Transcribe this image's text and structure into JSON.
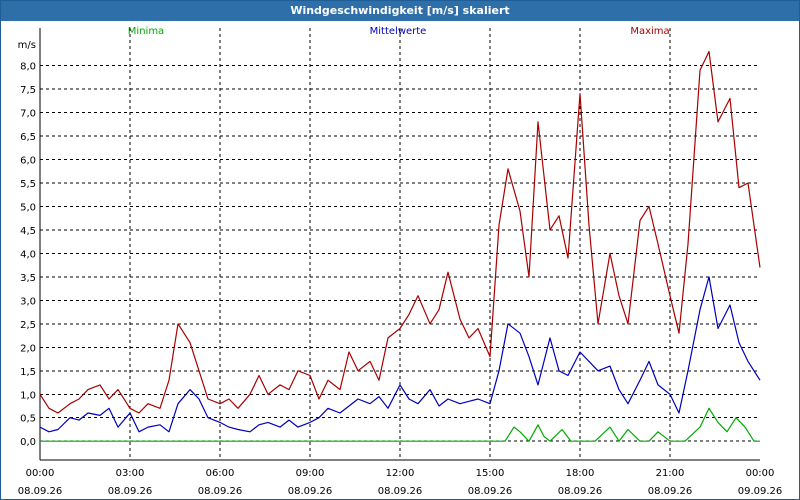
{
  "window": {
    "title": "Windgeschwindigkeit [m/s] skaliert"
  },
  "chart_data": {
    "type": "line",
    "ylabel": "m/s",
    "ylim": [
      -0.4,
      8.8
    ],
    "yticks": [
      "0,0",
      "0,5",
      "1,0",
      "1,5",
      "2,0",
      "2,5",
      "3,0",
      "3,5",
      "4,0",
      "4,5",
      "5,0",
      "5,5",
      "6,0",
      "6,5",
      "7,0",
      "7,5",
      "8,0"
    ],
    "x_time_labels": [
      "00:00",
      "03:00",
      "06:00",
      "09:00",
      "12:00",
      "15:00",
      "18:00",
      "21:00",
      "00:00"
    ],
    "x_date_labels": [
      "08.09.26",
      "08.09.26",
      "08.09.26",
      "08.09.26",
      "08.09.26",
      "08.09.26",
      "08.09.26",
      "08.09.26",
      "09.09.26"
    ],
    "x_hours": [
      0,
      24
    ],
    "grid": true,
    "legend": {
      "placement": "top"
    },
    "series": [
      {
        "name": "Minima",
        "color": "#00aa00",
        "x": [
          0,
          0.5,
          1,
          1.5,
          2,
          2.5,
          3,
          3.5,
          4,
          4.5,
          5,
          5.5,
          6,
          6.5,
          7,
          7.5,
          8,
          8.5,
          9,
          9.5,
          10,
          10.5,
          11,
          11.5,
          12,
          12.5,
          13,
          13.5,
          14,
          14.5,
          15,
          15.2,
          15.5,
          15.8,
          16.0,
          16.3,
          16.6,
          16.8,
          17.0,
          17.4,
          17.7,
          18.0,
          18.5,
          19,
          19.3,
          19.6,
          20,
          20.3,
          20.6,
          21,
          21.5,
          22,
          22.3,
          22.6,
          22.9,
          23.2,
          23.5,
          23.8,
          24
        ],
        "values": [
          0,
          0,
          0,
          0,
          0,
          0,
          0,
          0,
          0,
          0,
          0,
          0,
          0,
          0,
          0,
          0,
          0,
          0,
          0,
          0,
          0,
          0,
          0,
          0,
          0,
          0,
          0,
          0,
          0,
          0,
          0,
          0,
          0,
          0.3,
          0.2,
          0,
          0.35,
          0.1,
          0,
          0.25,
          0,
          0,
          0,
          0.3,
          0,
          0.25,
          0,
          0,
          0.2,
          0,
          0,
          0.3,
          0.7,
          0.4,
          0.2,
          0.5,
          0.3,
          0,
          0
        ]
      },
      {
        "name": "Mittelwerte",
        "color": "#0000bb",
        "x": [
          0,
          0.3,
          0.6,
          1,
          1.3,
          1.6,
          2,
          2.3,
          2.6,
          3,
          3.3,
          3.6,
          4,
          4.3,
          4.6,
          5,
          5.3,
          5.6,
          6,
          6.3,
          6.6,
          7,
          7.3,
          7.6,
          8,
          8.3,
          8.6,
          9,
          9.3,
          9.6,
          10,
          10.3,
          10.6,
          11,
          11.3,
          11.6,
          12,
          12.3,
          12.6,
          13,
          13.3,
          13.6,
          14,
          14.3,
          14.6,
          15,
          15.3,
          15.6,
          16,
          16.3,
          16.6,
          17,
          17.3,
          17.6,
          18,
          18.3,
          18.6,
          19,
          19.3,
          19.6,
          20,
          20.3,
          20.6,
          21,
          21.3,
          21.6,
          22,
          22.3,
          22.6,
          23,
          23.3,
          23.6,
          24
        ],
        "values": [
          0.3,
          0.2,
          0.25,
          0.5,
          0.45,
          0.6,
          0.55,
          0.7,
          0.3,
          0.6,
          0.2,
          0.3,
          0.35,
          0.2,
          0.8,
          1.1,
          0.9,
          0.5,
          0.4,
          0.3,
          0.25,
          0.2,
          0.35,
          0.4,
          0.3,
          0.45,
          0.3,
          0.4,
          0.5,
          0.7,
          0.6,
          0.75,
          0.9,
          0.8,
          0.95,
          0.7,
          1.2,
          0.9,
          0.8,
          1.1,
          0.75,
          0.9,
          0.8,
          0.85,
          0.9,
          0.8,
          1.5,
          2.5,
          2.3,
          1.8,
          1.2,
          2.2,
          1.5,
          1.4,
          1.9,
          1.7,
          1.5,
          1.6,
          1.1,
          0.8,
          1.3,
          1.7,
          1.2,
          1.0,
          0.6,
          1.5,
          2.8,
          3.5,
          2.4,
          2.9,
          2.1,
          1.7,
          1.3
        ]
      },
      {
        "name": "Maxima",
        "color": "#aa0000",
        "x": [
          0,
          0.3,
          0.6,
          1,
          1.3,
          1.6,
          2,
          2.3,
          2.6,
          3,
          3.3,
          3.6,
          4,
          4.3,
          4.6,
          5,
          5.3,
          5.6,
          6,
          6.3,
          6.6,
          7,
          7.3,
          7.6,
          8,
          8.3,
          8.6,
          9,
          9.3,
          9.6,
          10,
          10.3,
          10.6,
          11,
          11.3,
          11.6,
          12,
          12.3,
          12.6,
          13,
          13.3,
          13.6,
          14,
          14.3,
          14.6,
          15,
          15.3,
          15.6,
          16,
          16.3,
          16.6,
          17,
          17.3,
          17.6,
          18,
          18.3,
          18.6,
          19,
          19.3,
          19.6,
          20,
          20.3,
          20.6,
          21,
          21.3,
          21.6,
          22,
          22.3,
          22.6,
          23,
          23.3,
          23.6,
          24
        ],
        "values": [
          1.0,
          0.7,
          0.6,
          0.8,
          0.9,
          1.1,
          1.2,
          0.9,
          1.1,
          0.7,
          0.6,
          0.8,
          0.7,
          1.3,
          2.5,
          2.1,
          1.5,
          0.9,
          0.8,
          0.9,
          0.7,
          1.0,
          1.4,
          1.0,
          1.2,
          1.1,
          1.5,
          1.4,
          0.9,
          1.3,
          1.1,
          1.9,
          1.5,
          1.7,
          1.3,
          2.2,
          2.4,
          2.7,
          3.1,
          2.5,
          2.8,
          3.6,
          2.6,
          2.2,
          2.4,
          1.8,
          4.6,
          5.8,
          4.9,
          3.5,
          6.8,
          4.5,
          4.8,
          3.9,
          7.4,
          4.6,
          2.5,
          4.0,
          3.1,
          2.5,
          4.7,
          5.0,
          4.2,
          3.1,
          2.3,
          4.2,
          7.9,
          8.3,
          6.8,
          7.3,
          5.4,
          5.5,
          3.7
        ]
      }
    ]
  }
}
